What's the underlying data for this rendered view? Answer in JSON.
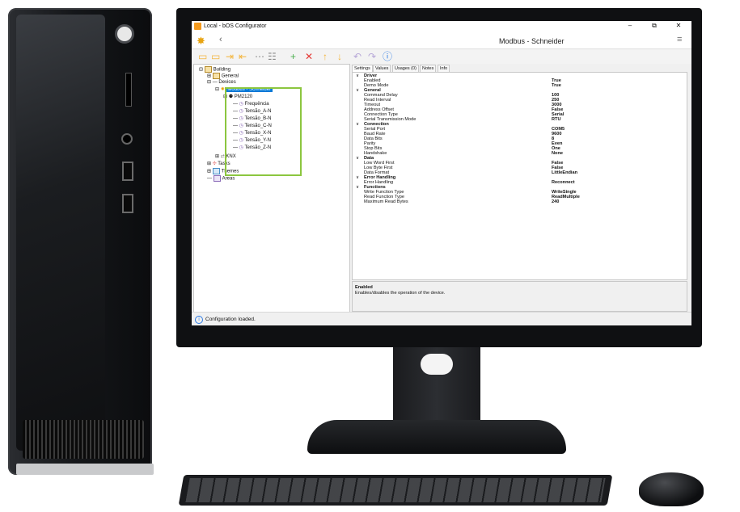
{
  "window": {
    "title": "Local - bOS Configurator",
    "minimize": "–",
    "maximize": "⧉",
    "close": "✕"
  },
  "header": {
    "back_icon": "‹",
    "doc_title": "Modbus - Schneider",
    "menu_icon": "≡"
  },
  "toolbar": {
    "icons": [
      "new-icon",
      "open-icon",
      "import-icon",
      "export-icon",
      "more-icon",
      "properties-icon",
      "add-icon",
      "delete-icon",
      "move-up-icon",
      "move-down-icon",
      "undo-icon",
      "redo-icon",
      "help-icon"
    ]
  },
  "tree": {
    "building": "Building",
    "general": "General",
    "devices": "Devices",
    "modbus": "Modbus - Schneider",
    "pm": "PM2120",
    "points": [
      "Frequência",
      "Tensão_A-N",
      "Tensão_B-N",
      "Tensão_C-N",
      "Tensão_X-N",
      "Tensão_Y-N",
      "Tensão_Z-N"
    ],
    "knx": "KNX",
    "tasks": "Tasks",
    "themes": "Themes",
    "areas": "Areas"
  },
  "tabs": [
    "Settings",
    "Values",
    "Usages (0)",
    "Notes",
    "Info"
  ],
  "properties": [
    {
      "category": "Driver",
      "items": [
        [
          "Enabled",
          "True"
        ],
        [
          "Demo Mode",
          "True"
        ]
      ]
    },
    {
      "category": "General",
      "items": [
        [
          "Command Delay",
          "100"
        ],
        [
          "Read Interval",
          "250"
        ],
        [
          "Timeout",
          "3000"
        ],
        [
          "Address Offset",
          "False"
        ],
        [
          "Connection Type",
          "Serial"
        ],
        [
          "Serial Transmission Mode",
          "RTU"
        ]
      ]
    },
    {
      "category": "Connection",
      "items": [
        [
          "Serial Port",
          "COM5"
        ],
        [
          "Baud Rate",
          "9600"
        ],
        [
          "Data Bits",
          "8"
        ],
        [
          "Parity",
          "Even"
        ],
        [
          "Stop Bits",
          "One"
        ],
        [
          "Handshake",
          "None"
        ]
      ]
    },
    {
      "category": "Data",
      "items": [
        [
          "Low Word First",
          "False"
        ],
        [
          "Low Byte First",
          "False"
        ],
        [
          "Data Format",
          "LittleEndian"
        ]
      ]
    },
    {
      "category": "Error Handling",
      "items": [
        [
          "Error Handling",
          "Reconnect"
        ]
      ]
    },
    {
      "category": "Functions",
      "items": [
        [
          "Write Function Type",
          "WriteSingle"
        ],
        [
          "Read Function Type",
          "ReadMultiple"
        ],
        [
          "Maximum Read Bytes",
          "240"
        ]
      ]
    }
  ],
  "description": {
    "title": "Enabled",
    "text": "Enables/disables the operation of the device."
  },
  "status": {
    "icon": "i",
    "text": "Configuration loaded."
  }
}
